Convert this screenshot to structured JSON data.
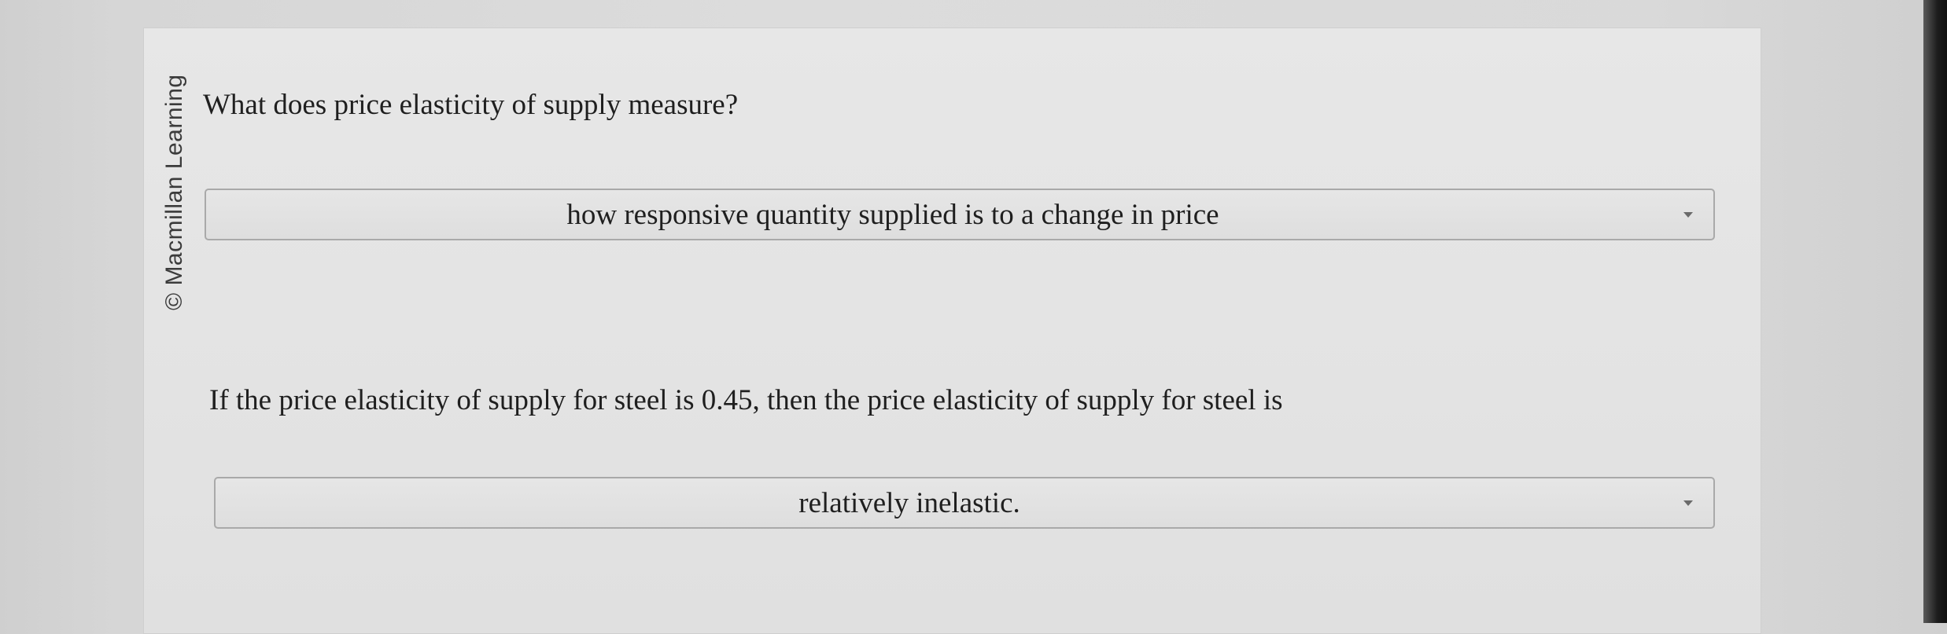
{
  "copyright": "© Macmillan Learning",
  "questions": [
    {
      "prompt": "What does price elasticity of supply measure?",
      "selected": "how responsive quantity supplied is to a change in price"
    },
    {
      "prompt": "If the price elasticity of supply for steel is 0.45, then the price elasticity of supply for steel is",
      "selected": "relatively inelastic."
    }
  ],
  "icons": {
    "dropdown": "chevron-down-icon"
  }
}
